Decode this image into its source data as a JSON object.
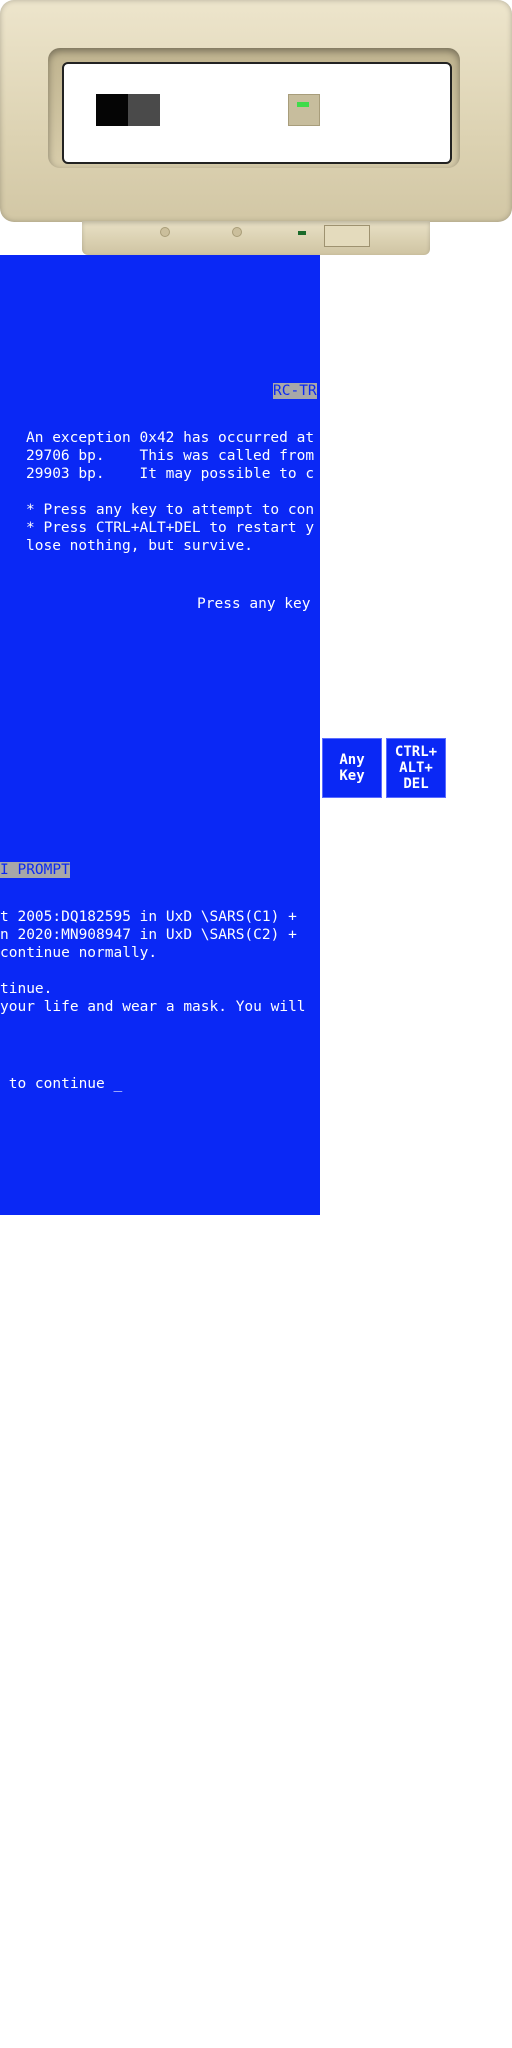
{
  "bsod": {
    "title_right": "RC-TR",
    "title_left": "I PROMPT",
    "block1_right": [
      "An exception 0x42 has occurred at",
      "29706 bp.    This was called from",
      "29903 bp.    It may possible to c",
      "",
      "* Press any key to attempt to con",
      "* Press CTRL+ALT+DEL to restart y",
      "lose nothing, but survive."
    ],
    "prompt_right": "Press any key",
    "block2_left": [
      "t 2005:DQ182595 in UxD \\SARS(C1) +",
      "n 2020:MN908947 in UxD \\SARS(C2) +",
      "continue normally.",
      "",
      "tinue.",
      "your life and wear a mask. You will"
    ],
    "prompt_left": " to continue _"
  },
  "buttons": {
    "any_key": "Any\nKey",
    "ctrl_alt_del": "CTRL+\nALT+\nDEL"
  }
}
